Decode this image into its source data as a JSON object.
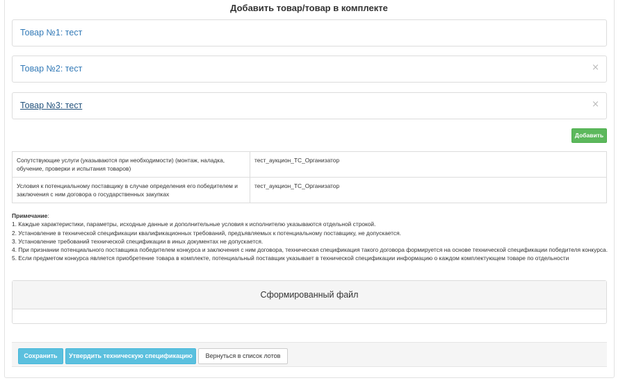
{
  "page": {
    "title": "Добавить товар/товар в комплекте"
  },
  "items": [
    {
      "label": "Товар №1: тест",
      "closable": false
    },
    {
      "label": "Товар №2: тест",
      "closable": true
    },
    {
      "label": "Товар №3: тест",
      "closable": true
    }
  ],
  "close_glyph": "×",
  "add_button_label": "Добавить",
  "info_table": {
    "rows": [
      {
        "label": "Сопутствующие услуги (указываются при необходимости) (монтаж, наладка, обучение, проверки и испытания товаров)",
        "value": "тест_аукцион_ТС_Организатор"
      },
      {
        "label": "Условия к потенциальному поставщику в случае определения его победителем и заключения с ним договора о государственных закупках",
        "value": "тест_аукцион_ТС_Организатор"
      }
    ]
  },
  "notes": {
    "heading": "Примечание",
    "colon": ":",
    "lines": [
      "1. Каждые характеристики, параметры, исходные данные и дополнительные условия к исполнителю указываются отдельной строкой.",
      "2. Установление в технической спецификации квалификационных требований, предъявляемых к потенциальному поставщику, не допускается.",
      "3. Установление требований технической спецификации в иных документах не допускается.",
      "4. При признании потенциального поставщика победителем конкурса и заключения с ним договора, техническая спецификация такого договора формируется на основе технической спецификации победителя конкурса.",
      "5. Если предметом конкурса является приобретение товара в комплекте, потенциальный поставщик указывает в технической спецификации информацию о каждом комплектующем товаре по отдельности"
    ]
  },
  "file_panel": {
    "title": "Сформированный файл"
  },
  "footer": {
    "save_label": "Сохранить",
    "approve_label": "Утвердить техническую спецификацию",
    "back_label": "Вернуться в список лотов"
  },
  "colors": {
    "link": "#337ab7",
    "success": "#5cb85c",
    "info": "#5bc0de",
    "border": "#dcdcdc"
  }
}
